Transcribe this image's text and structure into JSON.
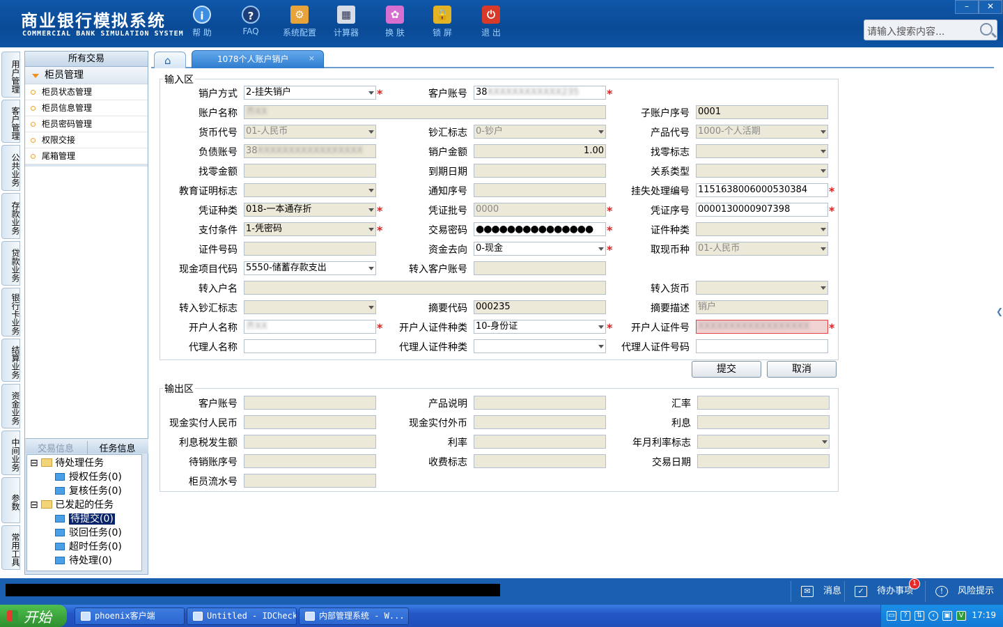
{
  "header": {
    "title_cn": "商业银行模拟系统",
    "title_en": "COMMERCIAL BANK SIMULATION SYSTEM",
    "toolbar": [
      {
        "label": "帮 助",
        "icon": "help-icon"
      },
      {
        "label": "FAQ",
        "icon": "faq-icon"
      },
      {
        "label": "系统配置",
        "icon": "config-icon"
      },
      {
        "label": "计算器",
        "icon": "calculator-icon"
      },
      {
        "label": "换 肤",
        "icon": "skin-icon"
      },
      {
        "label": "锁 屏",
        "icon": "lock-icon"
      },
      {
        "label": "退 出",
        "icon": "power-icon"
      }
    ],
    "search_placeholder": "请输入搜索内容..."
  },
  "vtabs": [
    "用户管理",
    "客户管理",
    "公共业务",
    "存款业务",
    "贷款业务",
    "银行卡业务",
    "结算业务",
    "资金业务",
    "中间业务",
    "参数",
    "常用工具"
  ],
  "left_panel": {
    "title": "所有交易",
    "group": "柜员管理",
    "items": [
      "柜员状态管理",
      "柜员信息管理",
      "柜员密码管理",
      "权限交接",
      "尾箱管理"
    ],
    "task_tabs": [
      "交易信息",
      "任务信息"
    ],
    "tree": {
      "pending": "待处理任务",
      "pending_children": [
        "授权任务(0)",
        "复核任务(0)"
      ],
      "initiated": "已发起的任务",
      "initiated_children": [
        "待提交(0)",
        "驳回任务(0)",
        "超时任务(0)",
        "待处理(0)"
      ]
    }
  },
  "tabs": {
    "current": "1078个人账户销户",
    "close": "×"
  },
  "form": {
    "input_legend": "输入区",
    "output_legend": "输出区",
    "labels": {
      "r1c1": "销户方式",
      "r1c2": "客户账号",
      "r2c1": "账户名称",
      "r2c3": "子账户序号",
      "r3c1": "货币代号",
      "r3c2": "钞汇标志",
      "r3c3": "产品代号",
      "r4c1": "负债账号",
      "r4c2": "销户金额",
      "r4c3": "找零标志",
      "r5c1": "找零金额",
      "r5c2": "到期日期",
      "r5c3": "关系类型",
      "r6c1": "教育证明标志",
      "r6c2": "通知序号",
      "r6c3": "挂失处理编号",
      "r7c1": "凭证种类",
      "r7c2": "凭证批号",
      "r7c3": "凭证序号",
      "r8c1": "支付条件",
      "r8c2": "交易密码",
      "r8c3": "证件种类",
      "r9c1": "证件号码",
      "r9c2": "资金去向",
      "r9c3": "取现币种",
      "r10c1": "现金项目代码",
      "r10c2": "转入客户账号",
      "r11c1": "转入户名",
      "r11c3": "转入货币",
      "r12c1": "转入钞汇标志",
      "r12c2": "摘要代码",
      "r12c3": "摘要描述",
      "r13c1": "开户人名称",
      "r13c2": "开户人证件种类",
      "r13c3": "开户人证件号",
      "r14c1": "代理人名称",
      "r14c2": "代理人证件种类",
      "r14c3": "代理人证件号码"
    },
    "values": {
      "r1c1": "2-挂失销户",
      "r1c2_prefix": "38",
      "r1c2_masked": "XXXXXXXXXXXX235",
      "r2c1_masked": "齐XX",
      "r2c3": "0001",
      "r3c1": "01-人民币",
      "r3c2": "0-钞户",
      "r3c3": "1000-个人活期",
      "r4c1_prefix": "38",
      "r4c1_masked": "XXXXXXXXXXXXXXXXX",
      "r4c2": "1.00",
      "r6c3": "1151638006000530384",
      "r7c1": "018-一本通存折",
      "r7c2": "0000",
      "r7c3": "0000130000907398",
      "r8c1": "1-凭密码",
      "r8c2": "●●●●●●●●●●●●●●●",
      "r9c2": "0-现金",
      "r9c3": "01-人民币",
      "r10c1": "5550-储蓄存款支出",
      "r12c2": "000235",
      "r12c3": "销户",
      "r13c1_masked": "齐XX",
      "r13c2": "10-身份证",
      "r13c3_masked": "XXXXXXXXXXXXXXXXXX"
    },
    "buttons": {
      "submit": "提交",
      "cancel": "取消"
    },
    "output_labels": {
      "o1c1": "客户账号",
      "o1c2": "产品说明",
      "o1c3": "汇率",
      "o2c1": "现金实付人民币",
      "o2c2": "现金实付外币",
      "o2c3": "利息",
      "o3c1": "利息税发生额",
      "o3c2": "利率",
      "o3c3": "年月利率标志",
      "o4c1": "待销账序号",
      "o4c2": "收费标志",
      "o4c3": "交易日期",
      "o5c1": "柜员流水号"
    },
    "required_mark": "*"
  },
  "statusbar": {
    "message": "消息",
    "todo": "待办事项",
    "todo_count": "1",
    "risk": "风险提示"
  },
  "taskbar": {
    "start": "开始",
    "tasks": [
      "phoenix客户端",
      "Untitled - IDCheck",
      "内部管理系统 - W..."
    ],
    "clock": "17:19"
  }
}
